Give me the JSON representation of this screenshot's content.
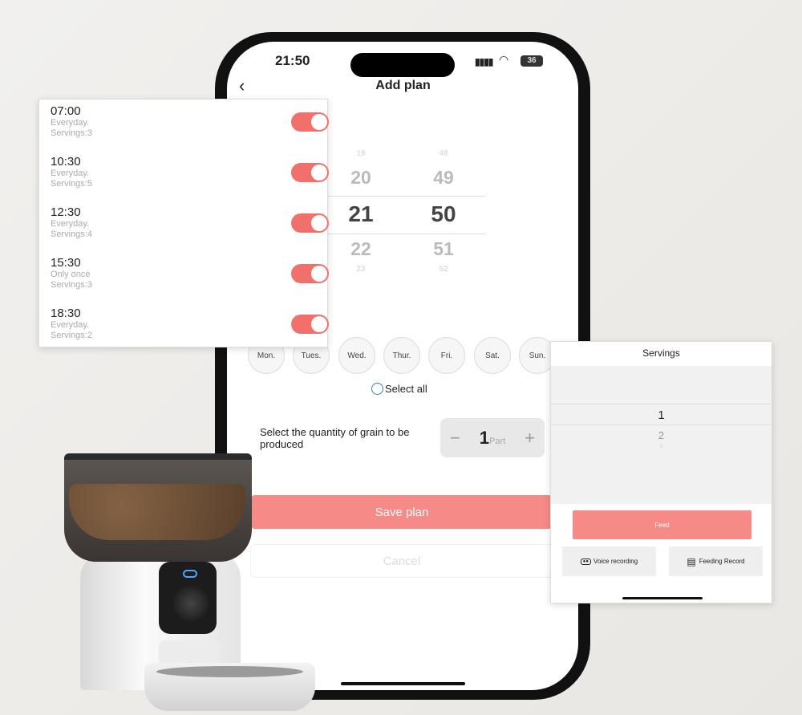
{
  "status_bar": {
    "time": "21:50",
    "battery": "36"
  },
  "header": {
    "back_icon": "chevron-left-icon",
    "title": "Add plan"
  },
  "time_picker": {
    "hours": [
      "19",
      "20",
      "21",
      "22",
      "23"
    ],
    "minutes": [
      "48",
      "49",
      "50",
      "51",
      "52"
    ],
    "selected_hour": "21",
    "selected_minute": "50"
  },
  "schedules": [
    {
      "time": "07:00",
      "repeat": "Everyday.",
      "servings": "Servings:3",
      "enabled": true
    },
    {
      "time": "10:30",
      "repeat": "Everyday.",
      "servings": "Servings:5",
      "enabled": true
    },
    {
      "time": "12:30",
      "repeat": "Everyday.",
      "servings": "Servings:4",
      "enabled": true
    },
    {
      "time": "15:30",
      "repeat": "Only once",
      "servings": "Servings:3",
      "enabled": true
    },
    {
      "time": "18:30",
      "repeat": "Everyday.",
      "servings": "Servings:2",
      "enabled": true
    }
  ],
  "days": [
    "Mon.",
    "Tues.",
    "Wed.",
    "Thur.",
    "Fri.",
    "Sat.",
    "Sun."
  ],
  "select_all": "Select all",
  "quantity": {
    "label": "Select the quantity of grain to be produced",
    "value": "1",
    "unit": "Part",
    "minus": "−",
    "plus": "+"
  },
  "save_label": "Save plan",
  "cancel_label": "Cancel",
  "servings_panel": {
    "title": "Servings",
    "values": [
      "1",
      "2",
      "3"
    ],
    "feed_label": "Feed",
    "voice_label": "Voice recording",
    "record_label": "Feeding Record"
  },
  "colors": {
    "accent": "#f58a86",
    "toggle": "#f2706c"
  }
}
